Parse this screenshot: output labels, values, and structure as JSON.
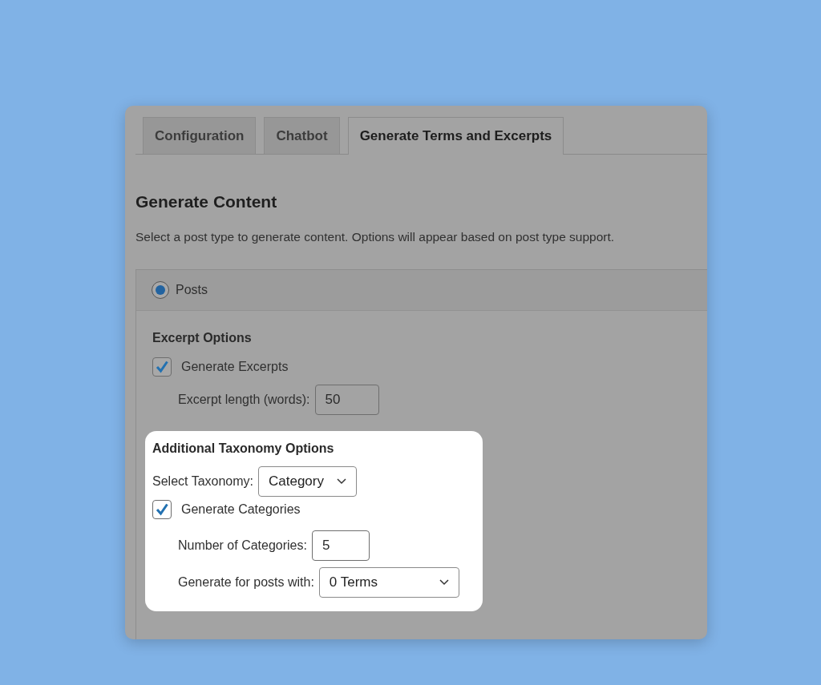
{
  "tabs": [
    {
      "label": "Configuration",
      "selected": false
    },
    {
      "label": "Chatbot",
      "selected": false
    },
    {
      "label": "Generate Terms and Excerpts",
      "selected": true
    }
  ],
  "section": {
    "title": "Generate Content",
    "description": "Select a post type to generate content. Options will appear based on post type support."
  },
  "post_types": [
    {
      "label": "Posts",
      "selected": true
    }
  ],
  "excerpt_options": {
    "heading": "Excerpt Options",
    "checkbox": {
      "label": "Generate Excerpts",
      "checked": true
    },
    "length": {
      "label": "Excerpt length (words):",
      "value": "50"
    }
  },
  "taxonomy": {
    "highlighted": true,
    "heading": "Additional Taxonomy Options",
    "select": {
      "label": "Select Taxonomy:",
      "value": "Category"
    },
    "checkbox": {
      "label": "Generate Categories",
      "checked": true
    },
    "count": {
      "label": "Number of Categories:",
      "value": "5"
    },
    "posts_with": {
      "label": "Generate for posts with:",
      "value": "0 Terms"
    }
  }
}
